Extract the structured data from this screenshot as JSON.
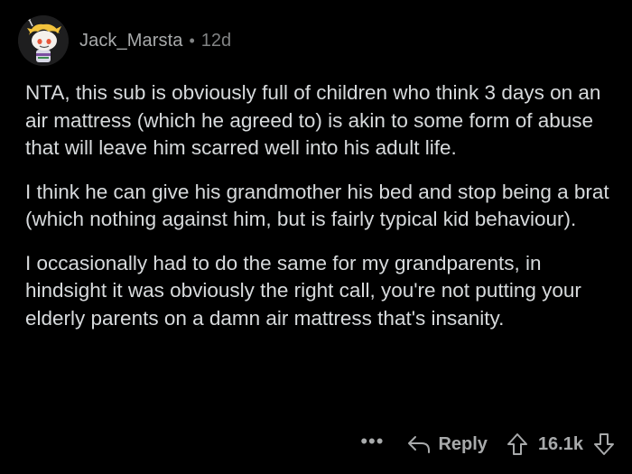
{
  "comment": {
    "author": "Jack_Marsta",
    "separator": "•",
    "age": "12d",
    "paragraphs": [
      "NTA, this sub is obviously full of children who think 3 days on an air mattress (which he agreed to) is akin to some form of abuse that will leave him scarred well into his adult life.",
      "I think he can give his grandmother his bed and stop being a brat (which nothing against him, but is fairly typical kid behaviour).",
      "I occasionally had to do the same for my grandparents, in hindsight it was obviously the right call, you're not putting your elderly parents on a damn air mattress that's insanity."
    ]
  },
  "actions": {
    "more_label": "•••",
    "reply_label": "Reply",
    "score": "16.1k"
  },
  "icons": {
    "avatar": "snoo-avatar",
    "reply": "reply-arrow-icon",
    "upvote": "upvote-arrow-icon",
    "downvote": "downvote-arrow-icon"
  },
  "colors": {
    "background": "#000000",
    "text": "#d7dadc",
    "meta": "#818384"
  }
}
